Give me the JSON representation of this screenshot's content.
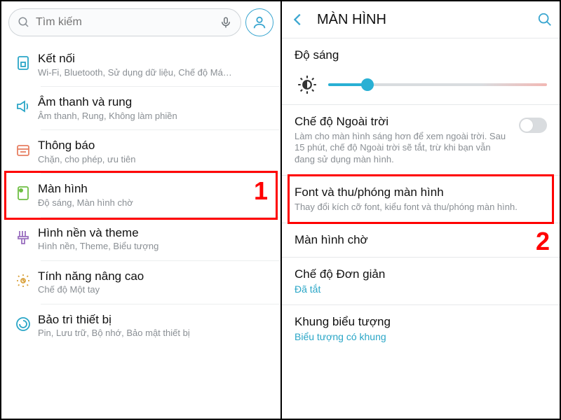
{
  "left": {
    "search_placeholder": "Tìm kiếm",
    "items": [
      {
        "title": "Kết nối",
        "sub": "Wi-Fi, Bluetooth, Sử dụng dữ liệu, Chế độ Má…",
        "icon": "sim",
        "color": "#2aa6c7"
      },
      {
        "title": "Âm thanh và rung",
        "sub": "Âm thanh, Rung, Không làm phiền",
        "icon": "sound",
        "color": "#2aa6c7"
      },
      {
        "title": "Thông báo",
        "sub": "Chặn, cho phép, ưu tiên",
        "icon": "badge",
        "color": "#e77f62"
      },
      {
        "title": "Màn hình",
        "sub": "Độ sáng, Màn hình chờ",
        "icon": "display",
        "color": "#6fbf44"
      },
      {
        "title": "Hình nền và theme",
        "sub": "Hình nền, Theme, Biểu tượng",
        "icon": "brush",
        "color": "#9a6fbf"
      },
      {
        "title": "Tính năng nâng cao",
        "sub": "Chế độ Một tay",
        "icon": "advanced",
        "color": "#d9a13b"
      },
      {
        "title": "Bảo trì thiết bị",
        "sub": "Pin, Lưu trữ, Bộ nhớ, Bảo mật thiết bị",
        "icon": "maint",
        "color": "#2aa6c7"
      }
    ],
    "highlight_index": 3,
    "annotation": "1"
  },
  "right": {
    "title": "MÀN HÌNH",
    "brightness": {
      "label": "Độ sáng",
      "percent": 18
    },
    "outdoor": {
      "title": "Chế độ Ngoài trời",
      "desc": "Làm cho màn hình sáng hơn để xem ngoài trời. Sau 15 phút, chế độ Ngoài trời sẽ tắt, trừ khi bạn vẫn đang sử dụng màn hình.",
      "on": false
    },
    "font": {
      "title": "Font và thu/phóng màn hình",
      "desc": "Thay đổi kích cỡ font, kiểu font và thu/phóng màn hình."
    },
    "standby": {
      "title": "Màn hình chờ"
    },
    "simple": {
      "title": "Chế độ Đơn giản",
      "value": "Đã tắt"
    },
    "iconframe": {
      "title": "Khung biểu tượng",
      "value": "Biểu tượng có khung"
    },
    "annotation": "2"
  }
}
